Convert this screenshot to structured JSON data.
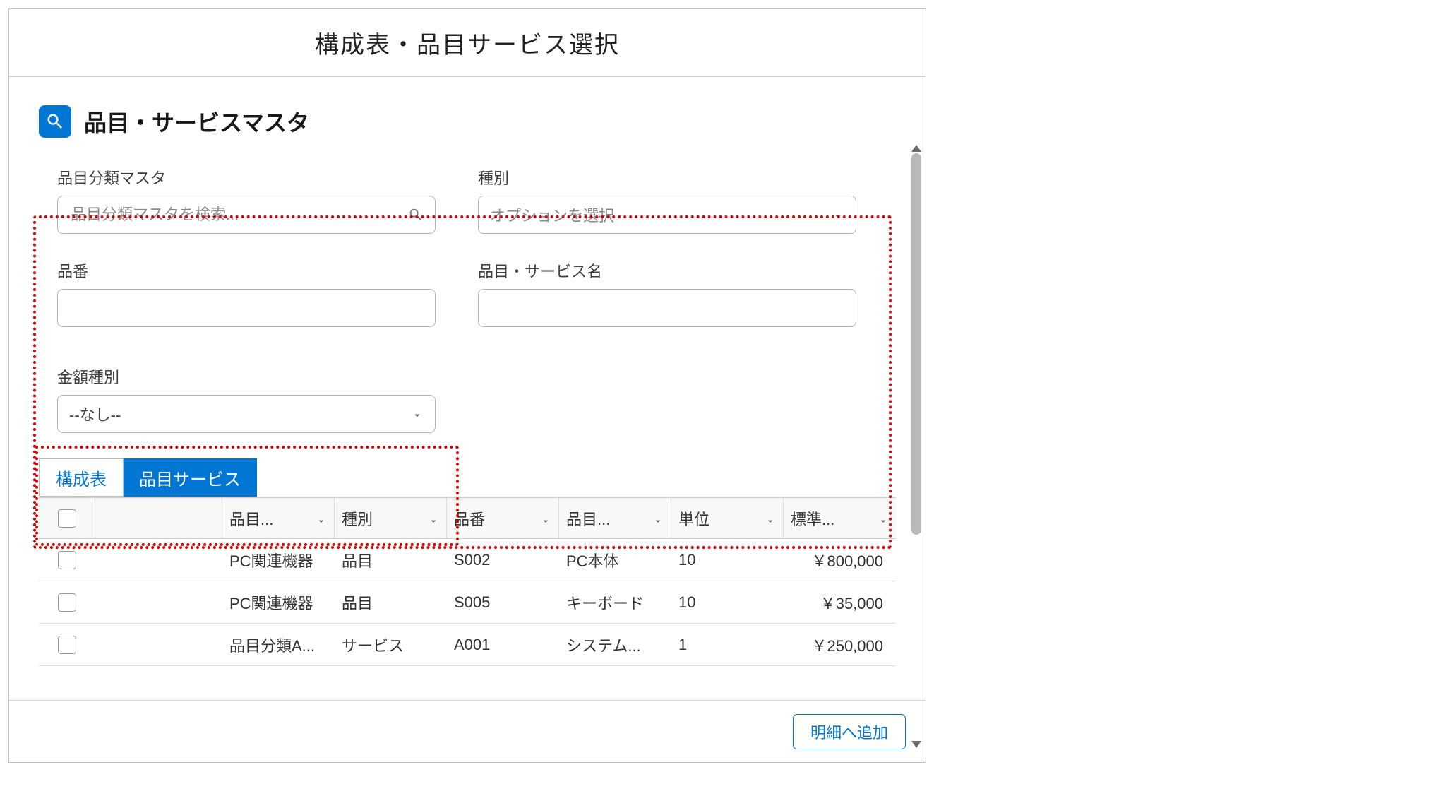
{
  "modal": {
    "title": "構成表・品目サービス選択"
  },
  "section": {
    "title": "品目・サービスマスタ"
  },
  "filters": {
    "classification": {
      "label": "品目分類マスタ",
      "placeholder": "品目分類マスタを検索...",
      "value": ""
    },
    "type": {
      "label": "種別",
      "placeholder": "オプションを選択",
      "value": ""
    },
    "part_no": {
      "label": "品番",
      "value": ""
    },
    "item_name": {
      "label": "品目・サービス名",
      "value": ""
    },
    "amount_type": {
      "label": "金額種別",
      "value": "--なし--"
    }
  },
  "tabs": {
    "bom": "構成表",
    "item_service": "品目サービス",
    "active": "item_service"
  },
  "columns": {
    "classification": "品目...",
    "type": "種別",
    "part_no": "品番",
    "name": "品目...",
    "unit": "単位",
    "std_price": "標準..."
  },
  "rows": [
    {
      "classification": "PC関連機器",
      "type": "品目",
      "part_no": "S002",
      "name": "PC本体",
      "unit": "10",
      "std_price": "￥800,000"
    },
    {
      "classification": "PC関連機器",
      "type": "品目",
      "part_no": "S005",
      "name": "キーボード",
      "unit": "10",
      "std_price": "￥35,000"
    },
    {
      "classification": "品目分類A...",
      "type": "サービス",
      "part_no": "A001",
      "name": "システム...",
      "unit": "1",
      "std_price": "￥250,000"
    }
  ],
  "footer": {
    "add_to_detail": "明細へ追加"
  },
  "colors": {
    "accent": "#0176d3",
    "highlight_border": "#d90000"
  }
}
